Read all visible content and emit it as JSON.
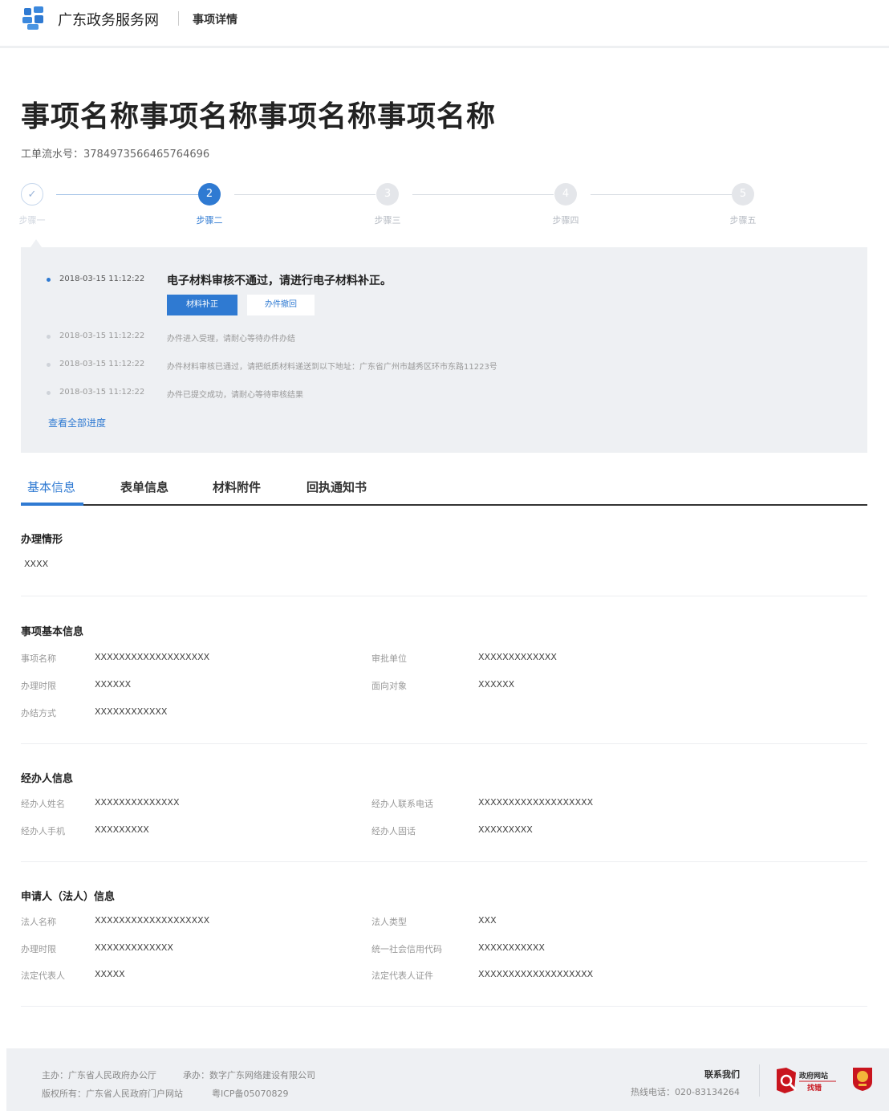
{
  "header": {
    "site_name": "广东政务服务网",
    "page_name": "事项详情",
    "logo_icon": "gd-gov-logo-icon"
  },
  "title": "事项名称事项名称事项名称事项名称",
  "serial": "工单流水号：3784973566465764696",
  "steps": [
    {
      "num": "✓",
      "label": "步骤一",
      "state": "done"
    },
    {
      "num": "2",
      "label": "步骤二",
      "state": "active"
    },
    {
      "num": "3",
      "label": "步骤三",
      "state": "todo"
    },
    {
      "num": "4",
      "label": "步骤四",
      "state": "todo"
    },
    {
      "num": "5",
      "label": "步骤五",
      "state": "todo"
    }
  ],
  "progress": {
    "rows": [
      {
        "time": "2018-03-15 11:12:22",
        "msg": "电子材料审核不通过，请进行电子材料补正。"
      },
      {
        "time": "2018-03-15 11:12:22",
        "msg": "办件进入受理，请耐心等待办件办结"
      },
      {
        "time": "2018-03-15 11:12:22",
        "msg": "办件材料审核已通过，请把纸质材料递送到以下地址：广东省广州市越秀区环市东路11223号"
      },
      {
        "time": "2018-03-15 11:12:22",
        "msg": "办件已提交成功，请耐心等待审核结果"
      }
    ],
    "btn_supplement": "材料补正",
    "btn_withdraw": "办件撤回",
    "view_all": "查看全部进度"
  },
  "tabs": [
    "基本信息",
    "表单信息",
    "材料附件",
    "回执通知书"
  ],
  "sections": {
    "situation": {
      "title": "办理情形",
      "value": "XXXX"
    },
    "basic": {
      "title": "事项基本信息",
      "items": [
        {
          "k": "事项名称",
          "v": "XXXXXXXXXXXXXXXXXXX"
        },
        {
          "k": "审批单位",
          "v": "XXXXXXXXXXXXX"
        },
        {
          "k": "办理时限",
          "v": "XXXXXX"
        },
        {
          "k": "面向对象",
          "v": "XXXXXX"
        },
        {
          "k": "办结方式",
          "v": "XXXXXXXXXXXX"
        }
      ]
    },
    "agent": {
      "title": "经办人信息",
      "items": [
        {
          "k": "经办人姓名",
          "v": "XXXXXXXXXXXXXX"
        },
        {
          "k": "经办人联系电话",
          "v": "XXXXXXXXXXXXXXXXXXX"
        },
        {
          "k": "经办人手机",
          "v": "XXXXXXXXX"
        },
        {
          "k": "经办人固话",
          "v": "XXXXXXXXX"
        }
      ]
    },
    "applicant": {
      "title": "申请人（法人）信息",
      "items": [
        {
          "k": "法人名称",
          "v": "XXXXXXXXXXXXXXXXXXX"
        },
        {
          "k": "法人类型",
          "v": "XXX"
        },
        {
          "k": "办理时限",
          "v": "XXXXXXXXXXXXX"
        },
        {
          "k": "统一社会信用代码",
          "v": "XXXXXXXXXXX"
        },
        {
          "k": "法定代表人",
          "v": "XXXXX"
        },
        {
          "k": "法定代表人证件",
          "v": "XXXXXXXXXXXXXXXXXXX"
        }
      ]
    }
  },
  "footer": {
    "sponsor": "主办：广东省人民政府办公厅",
    "organizer": "承办：数字广东网络建设有限公司",
    "copyright": "版权所有：广东省人民政府门户网站",
    "icp": "粤ICP备05070829",
    "contact": "联系我们",
    "hotline": "热线电话：020-83134264",
    "badge_text_1": "政府网站",
    "badge_text_2": "找错",
    "badge_icon": "gov-site-error-report-icon",
    "emblem_icon": "party-emblem-icon"
  },
  "colors": {
    "accent": "#2f7ad2",
    "panel": "#eef0f3"
  }
}
